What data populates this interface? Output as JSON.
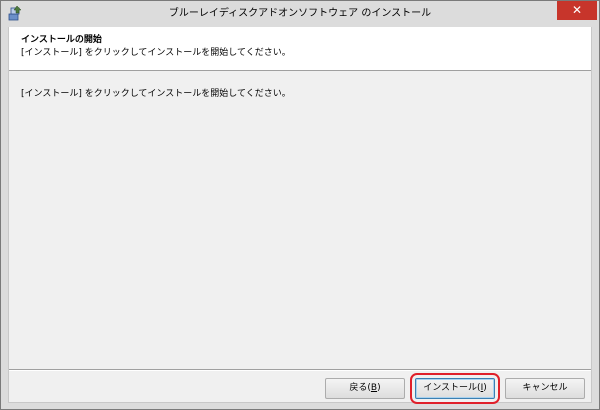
{
  "window": {
    "title": "ブルーレイディスクアドオンソフトウェア のインストール",
    "close_glyph": "✕"
  },
  "header": {
    "heading": "インストールの開始",
    "subtext": "[インストール] をクリックしてインストールを開始してください。"
  },
  "body": {
    "instruction": "[インストール] をクリックしてインストールを開始してください。"
  },
  "buttons": {
    "back": {
      "label": "戻る(",
      "mnemonic": "B",
      "suffix": ")"
    },
    "install": {
      "label": "インストール(",
      "mnemonic": "I",
      "suffix": ")"
    },
    "cancel": {
      "label": "キャンセル"
    }
  },
  "icons": {
    "app": "installer-icon",
    "close": "close-icon"
  },
  "colors": {
    "close_button": "#c7352b",
    "highlight": "#e0202a"
  }
}
